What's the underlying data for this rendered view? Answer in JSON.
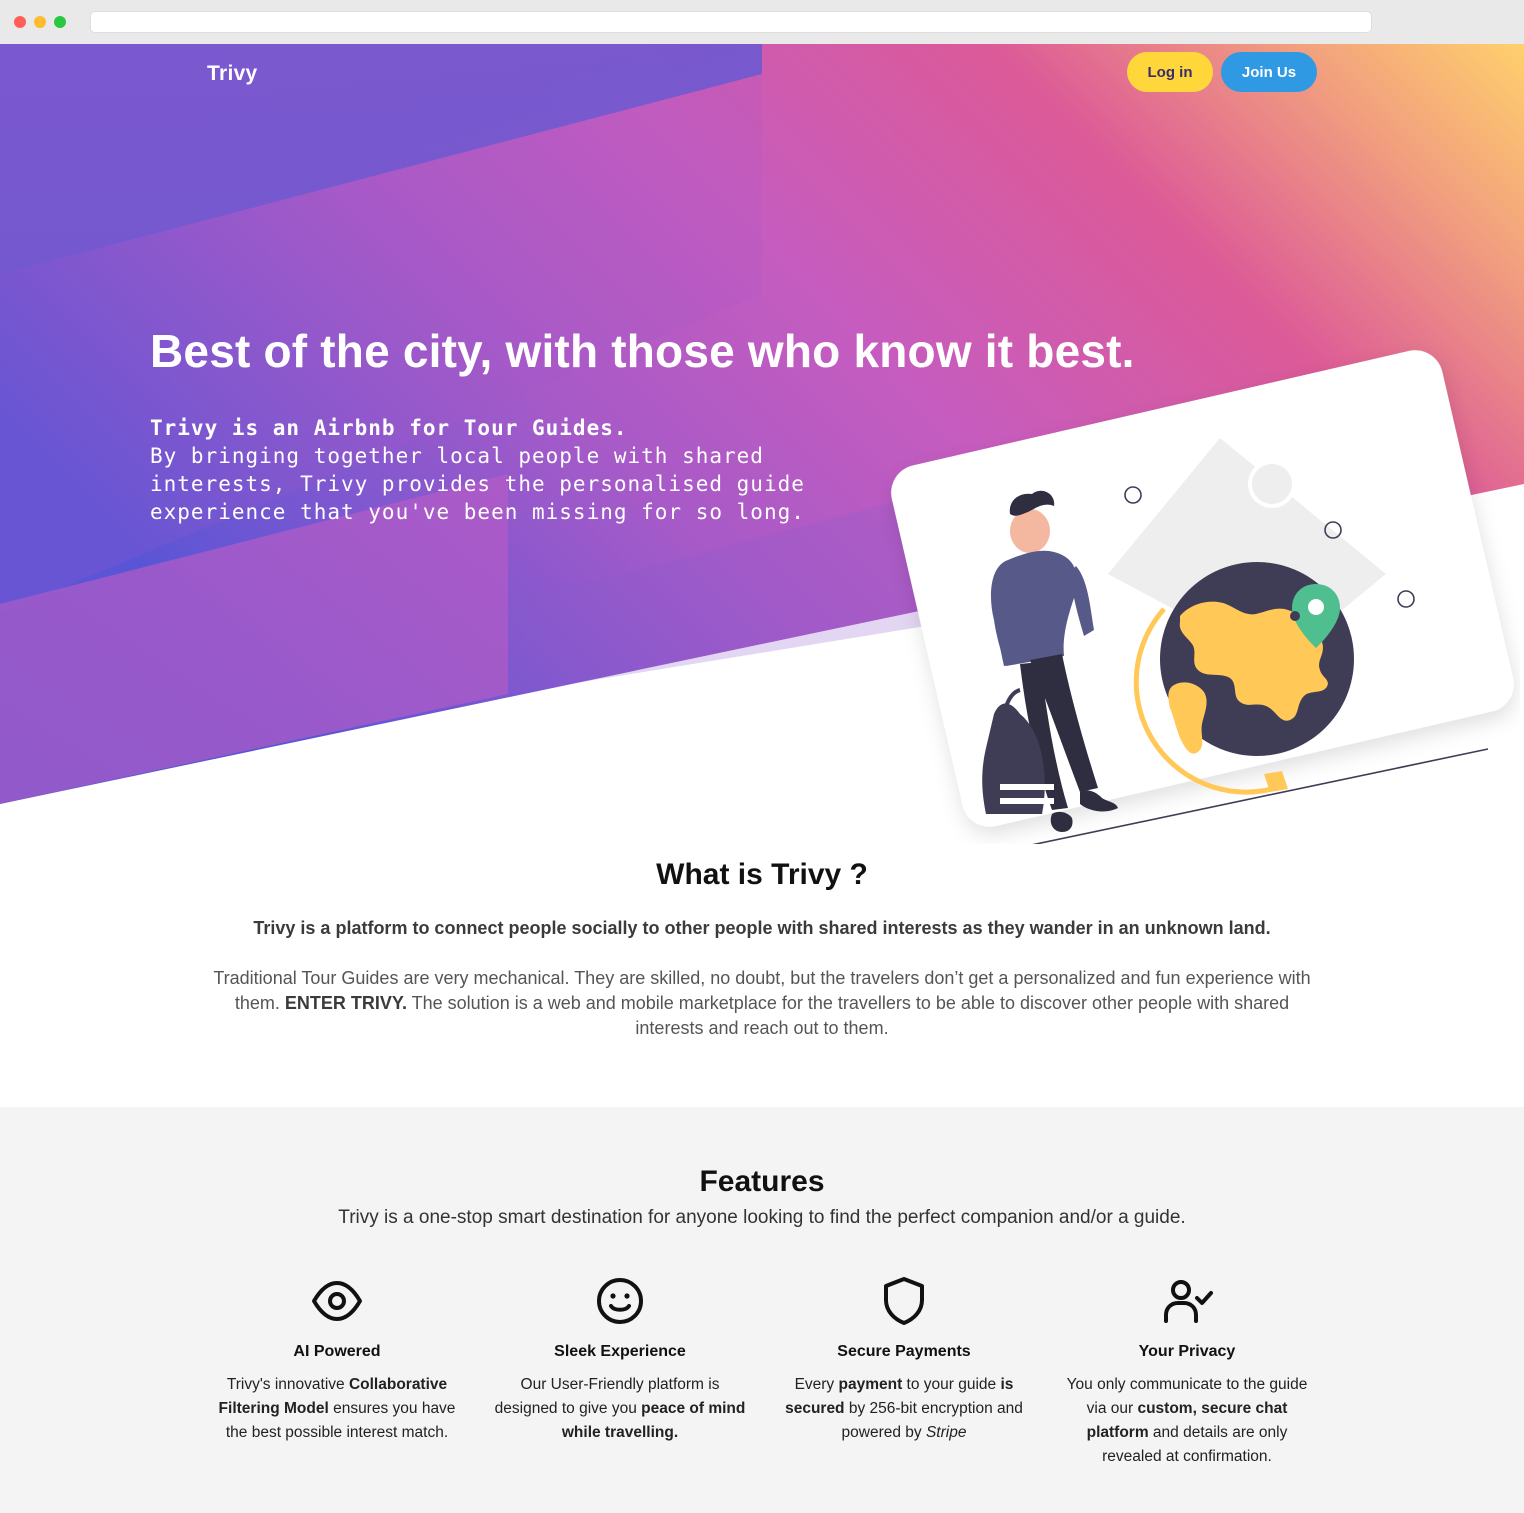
{
  "nav": {
    "brand": "Trivy",
    "login_label": "Log in",
    "join_label": "Join Us"
  },
  "hero": {
    "title": "Best of the city, with those who know it best.",
    "lead_strong": "Trivy is an Airbnb for Tour Guides.",
    "lead_rest": "By bringing together local people with shared interests, Trivy provides the personalised guide experience that you've been missing for so long."
  },
  "what": {
    "heading": "What is Trivy ?",
    "lead": "Trivy is a platform to connect people socially to other people with shared interests as they wander in an unknown land.",
    "body_part1": "Traditional Tour Guides are very mechanical. They are skilled, no doubt, but the travelers don’t get a personalized and fun experience with them.",
    "body_strong": "ENTER TRIVY.",
    "body_part2": "The solution is a web and mobile marketplace for the travellers to be able to discover other people with shared interests and reach out to them."
  },
  "features": {
    "heading": "Features",
    "subtitle": "Trivy is a one-stop smart destination for anyone looking to find the perfect companion and/or a guide.",
    "items": [
      {
        "icon": "eye-icon",
        "title": "AI Powered",
        "t1": "Trivy's innovative ",
        "b1": "Collaborative Filtering Model",
        "t2": " ensures you have the best possible interest match."
      },
      {
        "icon": "smile-icon",
        "title": "Sleek Experience",
        "t1": "Our User-Friendly platform is designed to give you ",
        "b1": "peace of mind while travelling."
      },
      {
        "icon": "shield-icon",
        "title": "Secure Payments",
        "t1": "Every ",
        "b1": "payment",
        "t2": " to your guide ",
        "b2": "is secured",
        "t3": " by 256-bit encryption and powered by ",
        "i1": "Stripe"
      },
      {
        "icon": "user-check-icon",
        "title": "Your Privacy",
        "t1": "You only communicate to the guide via our ",
        "b1": "custom, secure chat platform",
        "t2": " and details are only revealed at confirmation."
      }
    ]
  },
  "colors": {
    "gradient_purple": "#7257cf",
    "gradient_pink": "#d45aa8",
    "gradient_yellow": "#ffd36c",
    "login_button": "#ffd73a",
    "join_button": "#2f9ae3",
    "globe_land": "#ffc857",
    "globe_ocean": "#3f3d56",
    "pin_green": "#4fbf8f"
  }
}
